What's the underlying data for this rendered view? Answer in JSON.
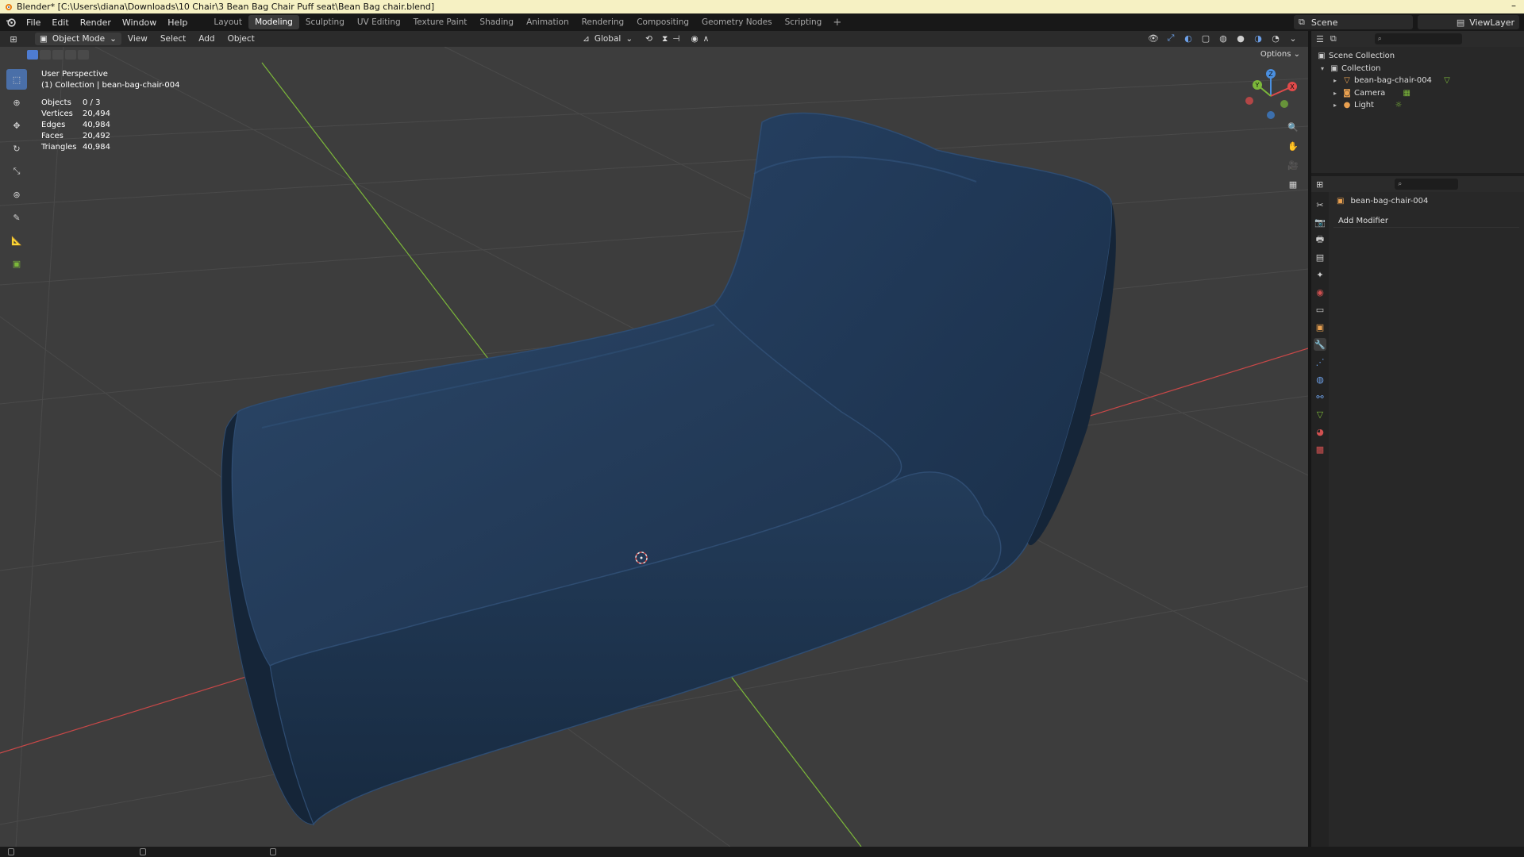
{
  "window": {
    "title": "Blender* [C:\\Users\\diana\\Downloads\\10 Chair\\3 Bean Bag Chair Puff seat\\Bean Bag chair.blend]"
  },
  "menu": [
    "File",
    "Edit",
    "Render",
    "Window",
    "Help"
  ],
  "workspaces": [
    "Layout",
    "Modeling",
    "Sculpting",
    "UV Editing",
    "Texture Paint",
    "Shading",
    "Animation",
    "Rendering",
    "Compositing",
    "Geometry Nodes",
    "Scripting"
  ],
  "active_workspace": "Modeling",
  "add_workspace": "+",
  "scene": {
    "name": "Scene"
  },
  "view_layer": {
    "name": "ViewLayer"
  },
  "viewport": {
    "mode": "Object Mode",
    "header_menus": [
      "View",
      "Select",
      "Add",
      "Object"
    ],
    "transform_orientation": "Global",
    "options_label": "Options",
    "info": {
      "perspective": "User Perspective",
      "collection": "(1) Collection | bean-bag-chair-004"
    },
    "stats": [
      {
        "label": "Objects",
        "value": "0 / 3"
      },
      {
        "label": "Vertices",
        "value": "20,494"
      },
      {
        "label": "Edges",
        "value": "40,984"
      },
      {
        "label": "Faces",
        "value": "20,492"
      },
      {
        "label": "Triangles",
        "value": "40,984"
      }
    ],
    "gizmo": {
      "x": "X",
      "y": "Y",
      "z": "Z"
    }
  },
  "outliner": {
    "root": "Scene Collection",
    "collection": "Collection",
    "items": [
      "bean-bag-chair-004",
      "Camera",
      "Light"
    ]
  },
  "properties": {
    "object_name": "bean-bag-chair-004",
    "add_modifier": "Add Modifier"
  },
  "colors": {
    "active_tab": "#4a6fa8",
    "x_axis": "#e04a4a",
    "y_axis": "#7cb83a",
    "z_axis": "#4a8fe0",
    "chair": "#223a5a"
  }
}
